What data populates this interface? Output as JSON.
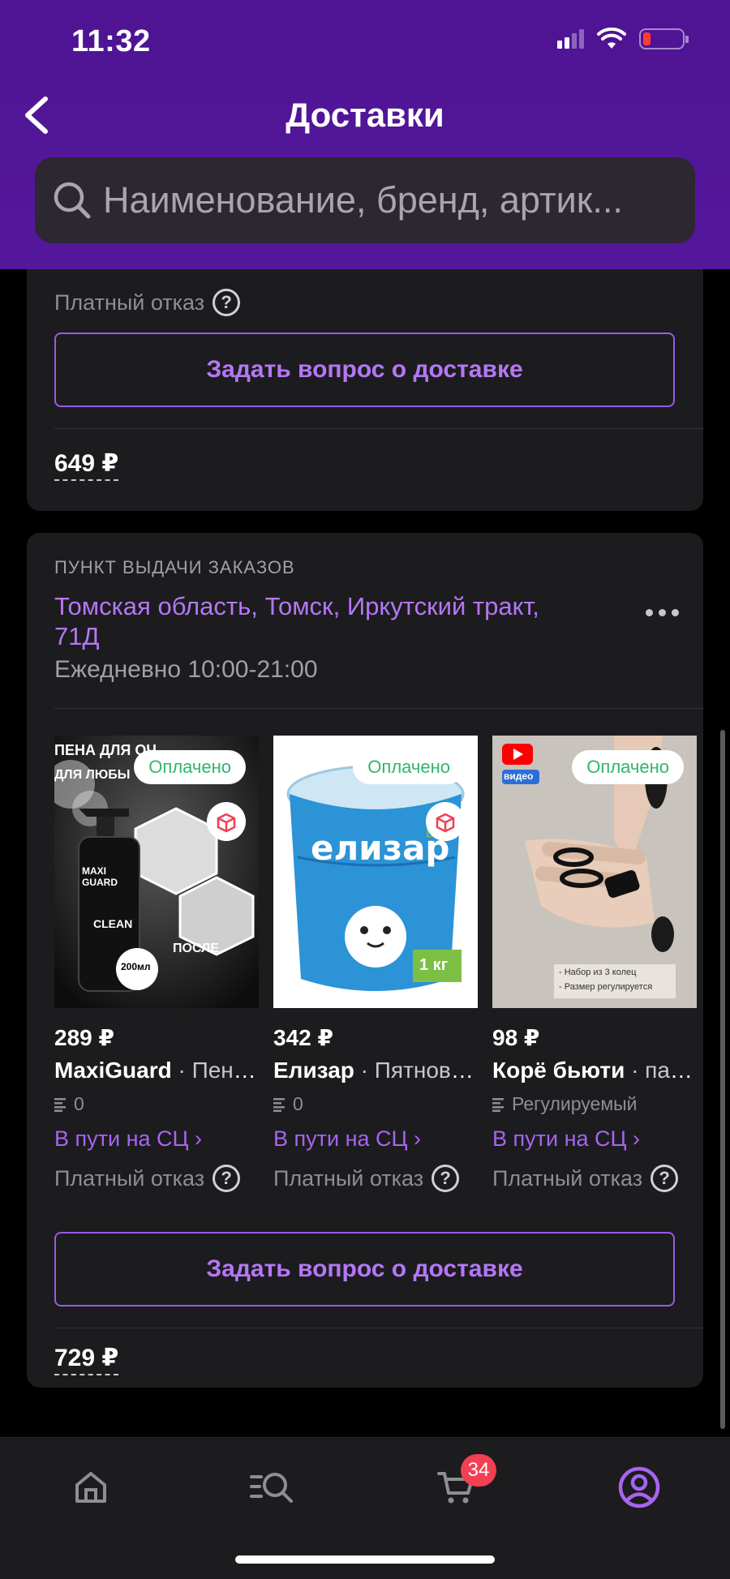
{
  "status_bar": {
    "time": "11:32"
  },
  "header": {
    "title": "Доставки"
  },
  "search": {
    "placeholder": "Наименование, бренд, артик..."
  },
  "card1": {
    "paid_refusal": "Платный отказ",
    "ask_button": "Задать вопрос о доставке",
    "total": "649 ₽"
  },
  "card2": {
    "pvz_label": "ПУНКТ ВЫДАЧИ ЗАКАЗОВ",
    "address": "Томская область, Томск, Иркутский тракт, 71Д",
    "hours": "Ежедневно 10:00-21:00",
    "products": [
      {
        "status_badge": "Оплачено",
        "price": "289 ₽",
        "brand": "MaxiGuard",
        "name": " · Пена для очистки",
        "reviews": "0",
        "delivery_status": "В пути на СЦ ›",
        "refusal": "Платный отказ",
        "image_texts": [
          "ПЕНА ДЛЯ ОЧ",
          "ДЛЯ ЛЮБЫ",
          "MAXI GUARD",
          "CLEAN",
          "200мл",
          "ПОСЛЕ"
        ]
      },
      {
        "status_badge": "Оплачено",
        "price": "342 ₽",
        "brand": "Елизар",
        "name": " · Пятновыводитель",
        "reviews": "0",
        "delivery_status": "В пути на СЦ ›",
        "refusal": "Платный отказ",
        "image_texts": [
          "елизар",
          "ECO",
          "1 кг"
        ]
      },
      {
        "status_badge": "Оплачено",
        "price": "98 ₽",
        "brand": "Корё бьюти",
        "name": " · пальцевые кольца",
        "reviews": "Регулируемый",
        "delivery_status": "В пути на СЦ ›",
        "refusal": "Платный отказ",
        "image_texts": [
          "видео",
          "- Набор из 3 колец",
          "- Размер регулируется"
        ]
      }
    ],
    "ask_button": "Задать вопрос о доставке",
    "total": "729 ₽"
  },
  "tabbar": {
    "items": [
      "home-icon",
      "catalog-search-icon",
      "cart-icon",
      "profile-icon"
    ],
    "cart_badge": "34",
    "active_color": "#a864f0"
  },
  "colors": {
    "accent": "#a864f0",
    "header": "#4e1493",
    "paid": "#32b56a",
    "badge": "#f23f52"
  }
}
